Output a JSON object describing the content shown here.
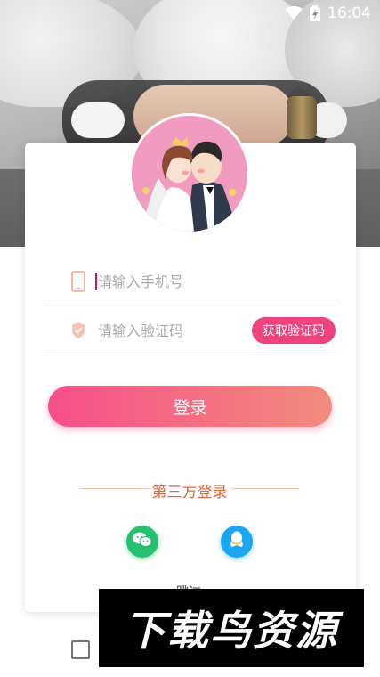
{
  "status_bar": {
    "time": "16:04",
    "icons": [
      "wifi-icon",
      "battery-charging-icon"
    ]
  },
  "login": {
    "phone_placeholder": "请输入手机号",
    "phone_value": "",
    "code_placeholder": "请输入验证码",
    "code_value": "",
    "get_code_label": "获取验证码",
    "login_label": "登录"
  },
  "third_party": {
    "title": "第三方登录",
    "options": [
      "wechat-icon",
      "qq-icon"
    ]
  },
  "skip_label": "跳过",
  "watermark_text": "下载鸟资源",
  "colors": {
    "accent": "#f0427c",
    "gradient_start": "#f54f8a",
    "gradient_end": "#f48b7c",
    "third_party_text": "#e2683c",
    "wechat": "#25c16f",
    "qq": "#1aa7f0"
  }
}
